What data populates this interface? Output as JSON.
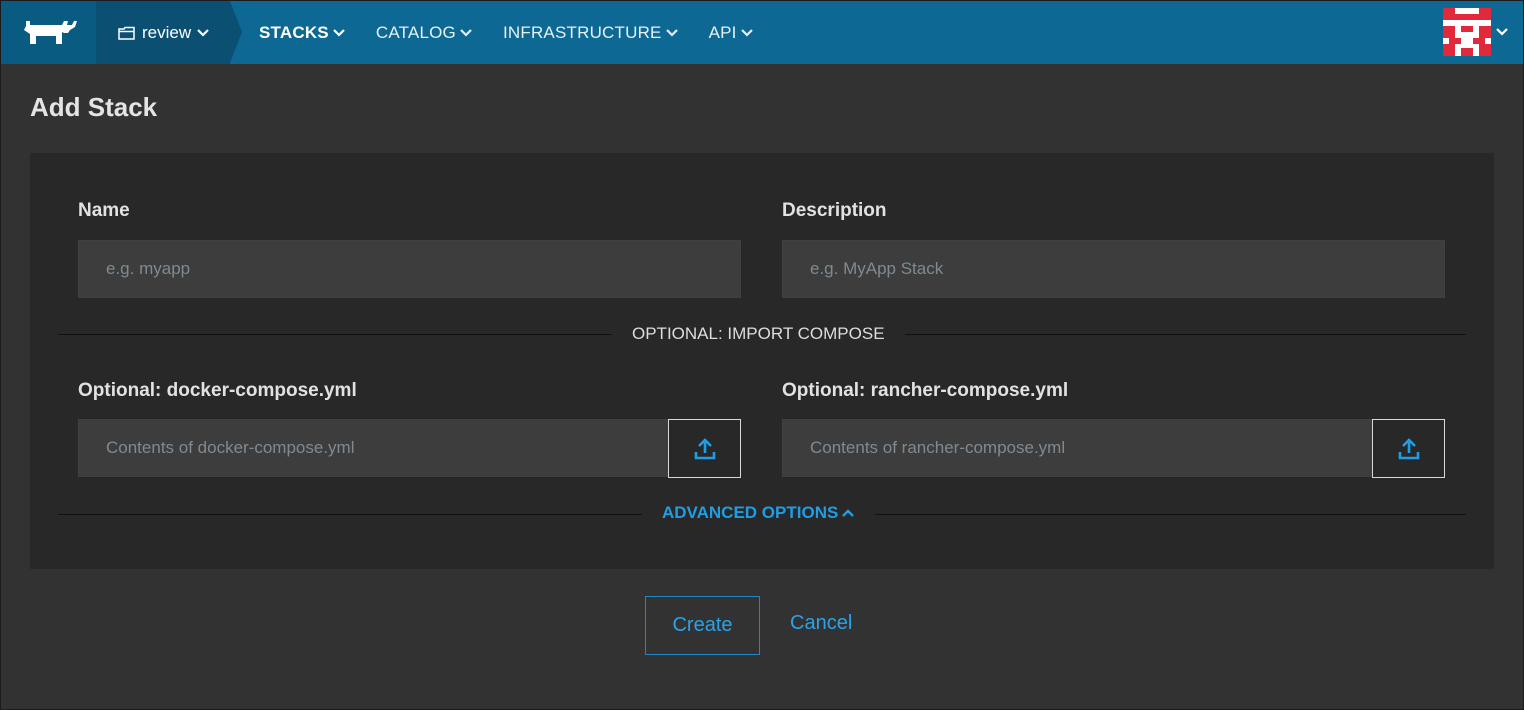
{
  "header": {
    "environment": "review",
    "nav": [
      {
        "label": "STACKS",
        "active": true
      },
      {
        "label": "CATALOG",
        "active": false
      },
      {
        "label": "INFRASTRUCTURE",
        "active": false
      },
      {
        "label": "API",
        "active": false
      }
    ],
    "icons": {
      "logo": "rancher-cow-logo-icon",
      "environment": "folder-icon",
      "dropdown": "chevron-down-icon",
      "avatar": "user-avatar-identicon"
    }
  },
  "page": {
    "title": "Add Stack"
  },
  "form": {
    "name": {
      "label": "Name",
      "placeholder": "e.g. myapp",
      "value": ""
    },
    "description": {
      "label": "Description",
      "placeholder": "e.g. MyApp Stack",
      "value": ""
    },
    "import_divider": "OPTIONAL: IMPORT COMPOSE",
    "docker_compose": {
      "label": "Optional: docker-compose.yml",
      "placeholder": "Contents of docker-compose.yml",
      "upload_icon": "upload-icon"
    },
    "rancher_compose": {
      "label": "Optional: rancher-compose.yml",
      "placeholder": "Contents of rancher-compose.yml",
      "upload_icon": "upload-icon"
    },
    "advanced": {
      "label": "ADVANCED OPTIONS",
      "icon": "chevron-up-icon"
    }
  },
  "actions": {
    "create": "Create",
    "cancel": "Cancel"
  },
  "colors": {
    "header_bg": "#0d6893",
    "env_bg": "#0b4f73",
    "page_bg": "#323232",
    "panel_bg": "#282828",
    "input_bg": "#3d3d3d",
    "accent": "#1f9ee5"
  }
}
